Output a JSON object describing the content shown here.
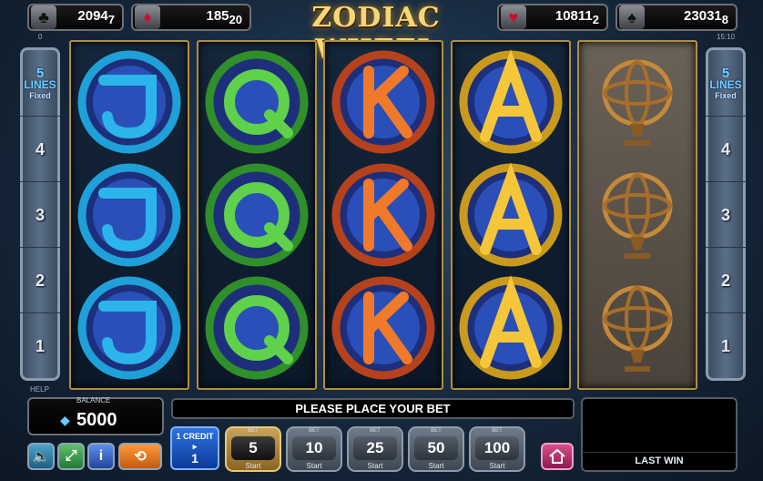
{
  "jackpots": [
    {
      "suit": "clubs",
      "main": "2094",
      "sub": "7"
    },
    {
      "suit": "diamonds",
      "main": "185",
      "sub": "20"
    },
    {
      "suit": "hearts",
      "main": "10811",
      "sub": "2"
    },
    {
      "suit": "spades",
      "main": "23031",
      "sub": "8"
    }
  ],
  "top_small": {
    "left": "0",
    "right": "15:10"
  },
  "title": "ZODIAC WHEEL",
  "lines_indicator": {
    "count": "5",
    "label": "LINES",
    "mode": "Fixed"
  },
  "line_numbers": [
    "4",
    "3",
    "2",
    "1"
  ],
  "reels": [
    {
      "symbol": "J",
      "color": "blue"
    },
    {
      "symbol": "Q",
      "color": "green"
    },
    {
      "symbol": "K",
      "color": "orange"
    },
    {
      "symbol": "A",
      "color": "gold"
    },
    {
      "symbol": "armillary-sphere",
      "color": "bronze"
    }
  ],
  "help_label": "HELP",
  "balance": {
    "label": "BALANCE",
    "value": "5000"
  },
  "message": "PLEASE PLACE YOUR BET",
  "credit": {
    "label": "1 CREDIT",
    "value": "1"
  },
  "bets": [
    {
      "header": "BET",
      "value": "5",
      "start": "Start",
      "active": true
    },
    {
      "header": "BET",
      "value": "10",
      "start": "Start",
      "active": false
    },
    {
      "header": "BET",
      "value": "25",
      "start": "Start",
      "active": false
    },
    {
      "header": "BET",
      "value": "50",
      "start": "Start",
      "active": false
    },
    {
      "header": "BET",
      "value": "100",
      "start": "Start",
      "active": false
    }
  ],
  "last_win_label": "LAST WIN",
  "icons": {
    "sound": "speaker-icon",
    "fullscreen": "fullscreen-icon",
    "info": "info-icon",
    "autoplay": "autoplay-icon",
    "home": "home-icon"
  },
  "colors": {
    "accent": "#f3d77a",
    "credit": "#2d73e0",
    "home": "#d94f8c"
  }
}
